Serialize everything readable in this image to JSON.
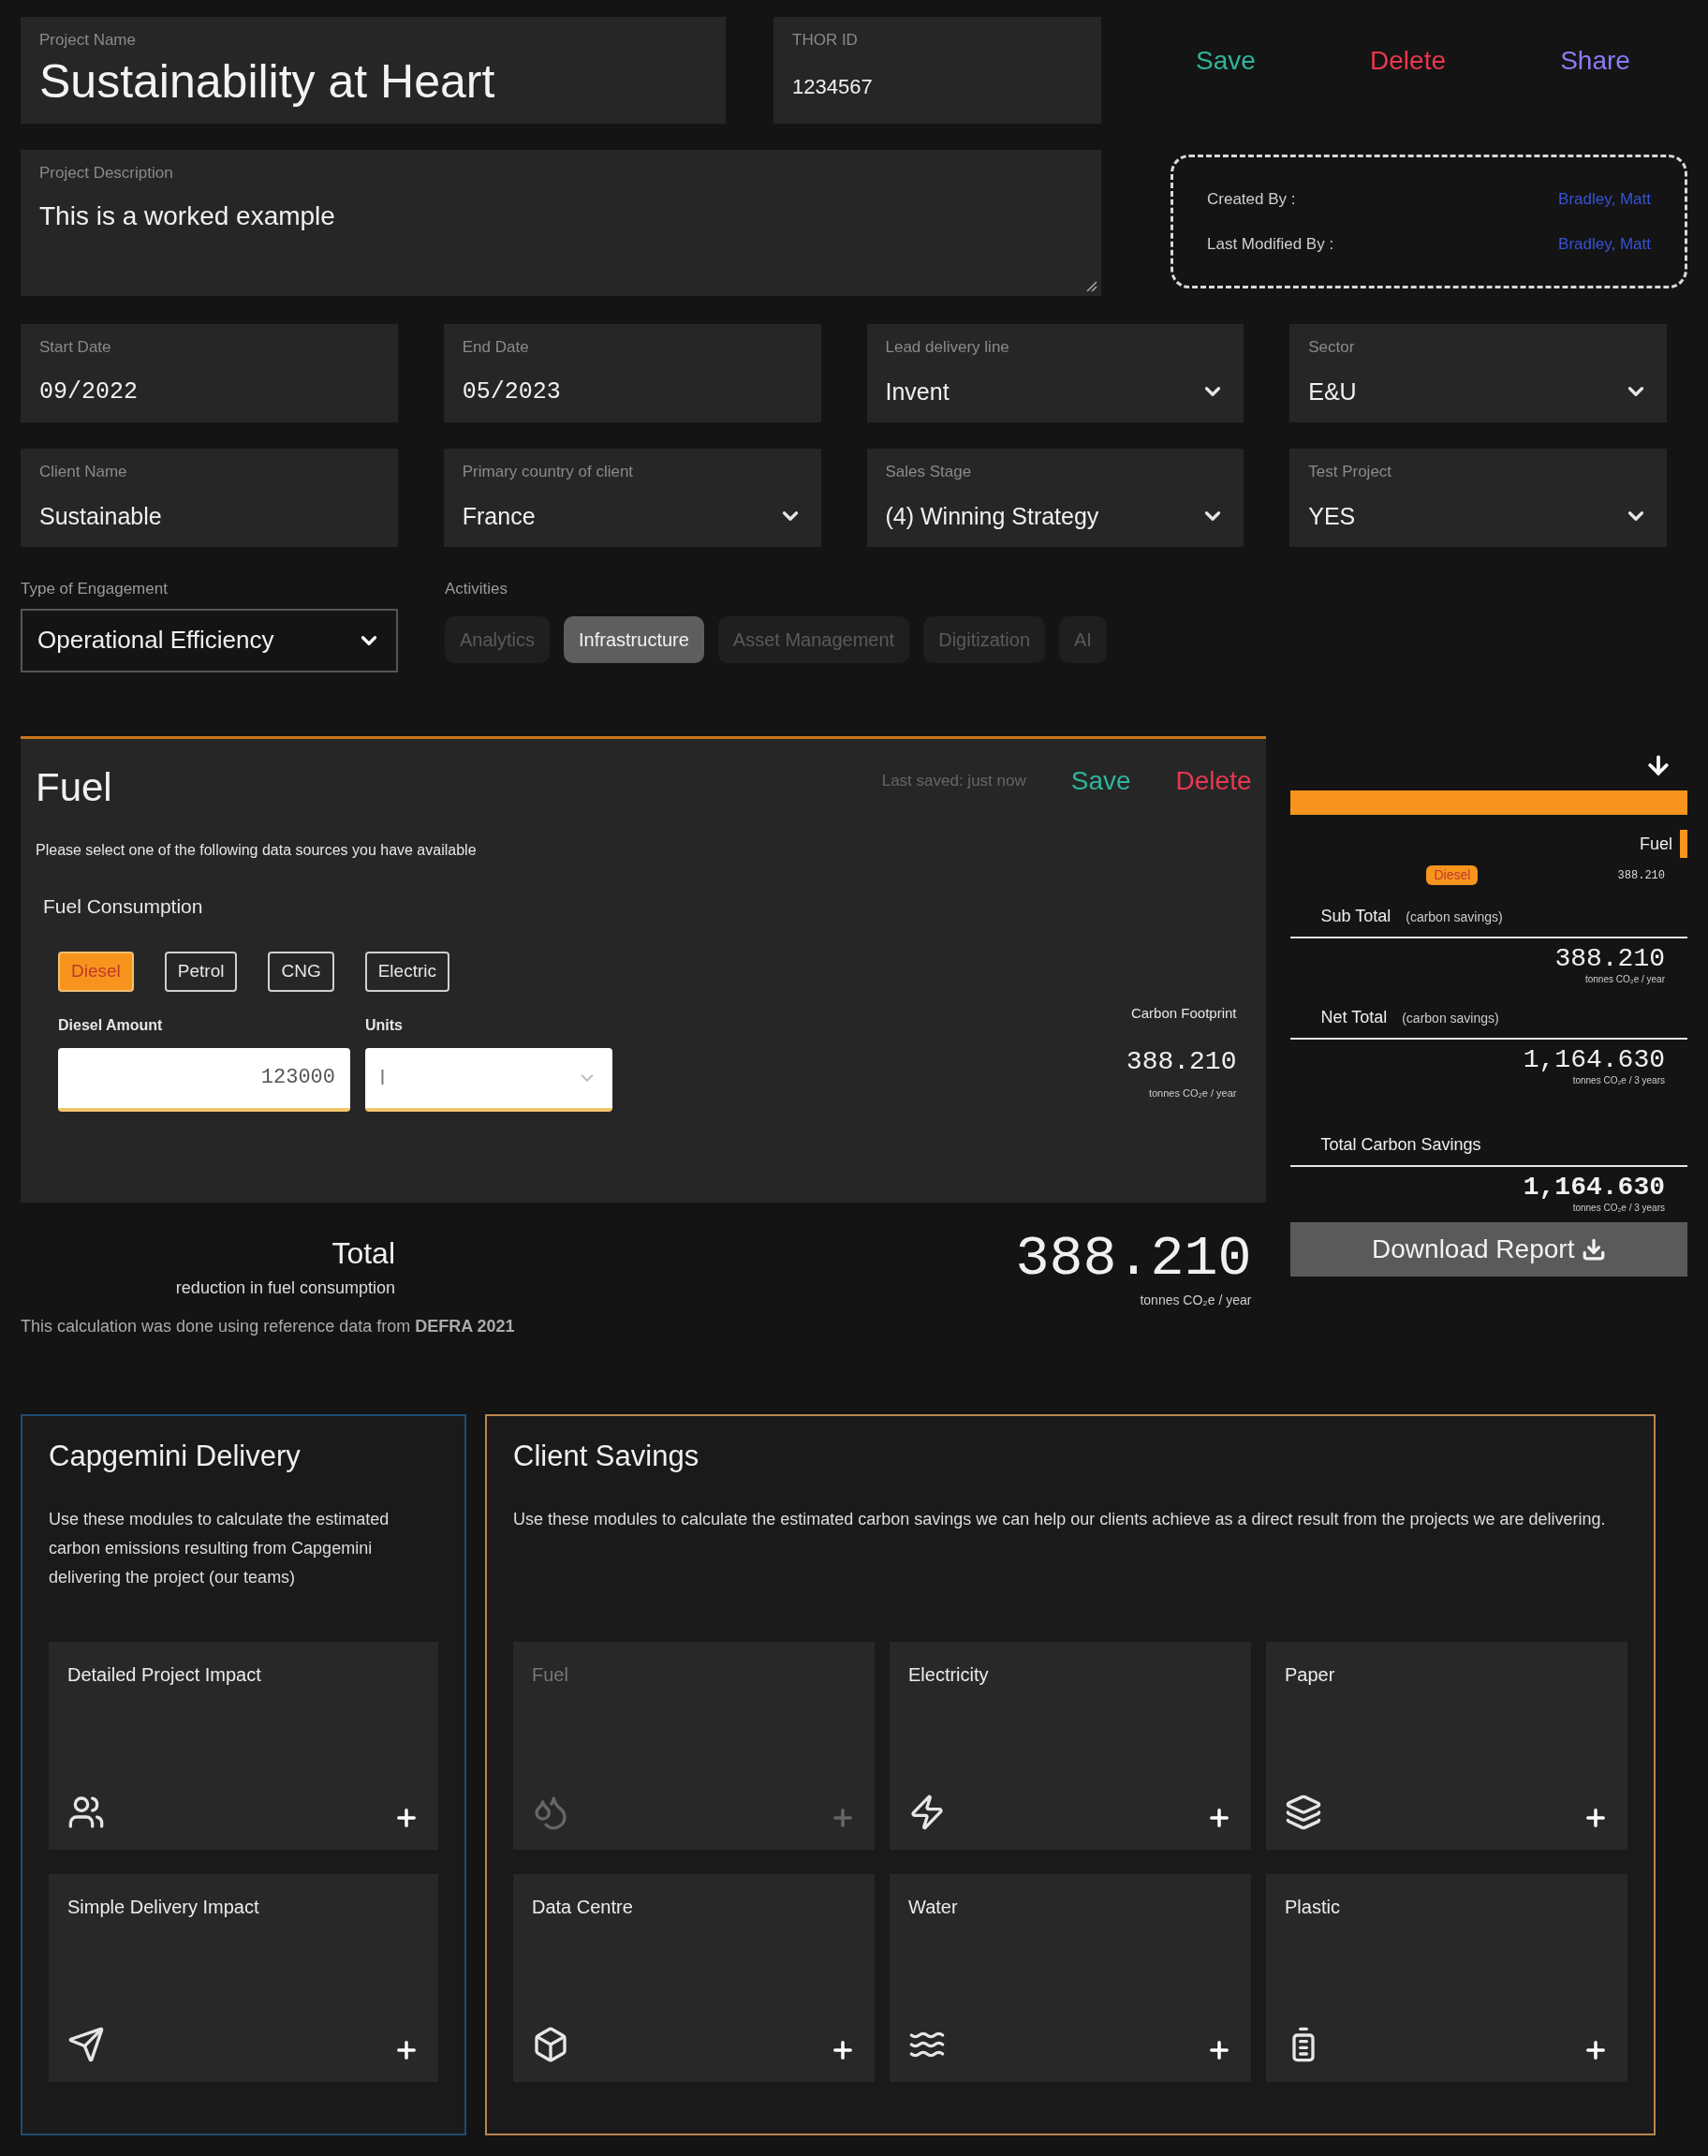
{
  "project": {
    "name_label": "Project Name",
    "name": "Sustainability at Heart",
    "thor_label": "THOR ID",
    "thor_id": "1234567"
  },
  "actions": [
    {
      "label": "Save",
      "kind": "save"
    },
    {
      "label": "Delete",
      "kind": "delete"
    },
    {
      "label": "Share",
      "kind": "share"
    }
  ],
  "description": {
    "label": "Project Description",
    "value": "This is a worked example"
  },
  "audit": [
    {
      "label": "Created By :",
      "value": "Bradley, Matt"
    },
    {
      "label": "Last Modified By :",
      "value": "Bradley, Matt"
    }
  ],
  "fields": [
    {
      "label": "Start Date",
      "value": "09/2022",
      "kind": "date"
    },
    {
      "label": "End Date",
      "value": "05/2023",
      "kind": "date"
    },
    {
      "label": "Lead delivery line",
      "value": "Invent",
      "kind": "select"
    },
    {
      "label": "Sector",
      "value": "E&U",
      "kind": "select"
    },
    {
      "label": "Client Name",
      "value": "Sustainable",
      "kind": "text"
    },
    {
      "label": "Primary country of client",
      "value": "France",
      "kind": "select"
    },
    {
      "label": "Sales Stage",
      "value": "(4) Winning Strategy",
      "kind": "select"
    },
    {
      "label": "Test Project",
      "value": "YES",
      "kind": "select"
    }
  ],
  "engagement": {
    "label": "Type of Engagement",
    "value": "Operational Efficiency"
  },
  "activities": {
    "label": "Activities",
    "items": [
      {
        "label": "Analytics",
        "selected": false
      },
      {
        "label": "Infrastructure",
        "selected": true
      },
      {
        "label": "Asset Management",
        "selected": false
      },
      {
        "label": "Digitization",
        "selected": false
      },
      {
        "label": "AI",
        "selected": false
      }
    ]
  },
  "fuel_panel": {
    "title": "Fuel",
    "last_saved": "Last saved: just now",
    "actions": [
      {
        "label": "Save",
        "kind": "save"
      },
      {
        "label": "Delete",
        "kind": "delete"
      }
    ],
    "instruction": "Please select one of the following data sources you have available",
    "section": "Fuel Consumption",
    "sources": [
      {
        "label": "Diesel",
        "selected": true
      },
      {
        "label": "Petrol",
        "selected": false
      },
      {
        "label": "CNG",
        "selected": false
      },
      {
        "label": "Electric",
        "selected": false
      }
    ],
    "amount": {
      "label": "Diesel Amount",
      "value": "123000"
    },
    "units": {
      "label": "Units",
      "value": "l"
    },
    "footprint": {
      "label": "Carbon Footprint",
      "value": "388.210",
      "unit": "tonnes CO₂e / year"
    }
  },
  "total": {
    "title": "Total",
    "subtitle": "reduction in fuel consumption",
    "value": "388.210",
    "unit": "tonnes CO₂e / year",
    "note": "This calculation was done using reference data from **DEFRA 2021**"
  },
  "summary": {
    "segments": [
      {
        "label": "Fuel",
        "color": "#f7941d"
      }
    ],
    "lines": [
      {
        "label": "Diesel",
        "value": "388.210"
      }
    ],
    "totals": [
      {
        "label": "Sub Total",
        "qualifier": "(carbon savings)",
        "value": "388.210",
        "unit": "tonnes CO₂e / year"
      },
      {
        "label": "Net Total",
        "qualifier": "(carbon savings)",
        "value": "1,164.630",
        "unit": "tonnes CO₂e / 3 years"
      },
      {
        "label": "Total Carbon Savings",
        "value": "1,164.630",
        "unit": "tonnes CO₂e / 3 years"
      }
    ],
    "download": "Download Report"
  },
  "delivery": {
    "title": "Capgemini Delivery",
    "text": "Use these modules to calculate the estimated carbon emissions resulting from Capgemini delivering the project (our teams)",
    "modules": [
      {
        "label": "Detailed Project Impact",
        "disabled": false
      },
      {
        "label": "Simple Delivery Impact",
        "disabled": false
      }
    ]
  },
  "client": {
    "title": "Client Savings",
    "text": "Use these modules to calculate the estimated carbon savings we can help our clients achieve as a direct result from the projects we are delivering.",
    "modules": [
      {
        "label": "Fuel",
        "disabled": true
      },
      {
        "label": "Electricity",
        "disabled": false
      },
      {
        "label": "Paper",
        "disabled": false
      },
      {
        "label": "Data Centre",
        "disabled": false
      },
      {
        "label": "Water",
        "disabled": false
      },
      {
        "label": "Plastic",
        "disabled": false
      }
    ]
  }
}
